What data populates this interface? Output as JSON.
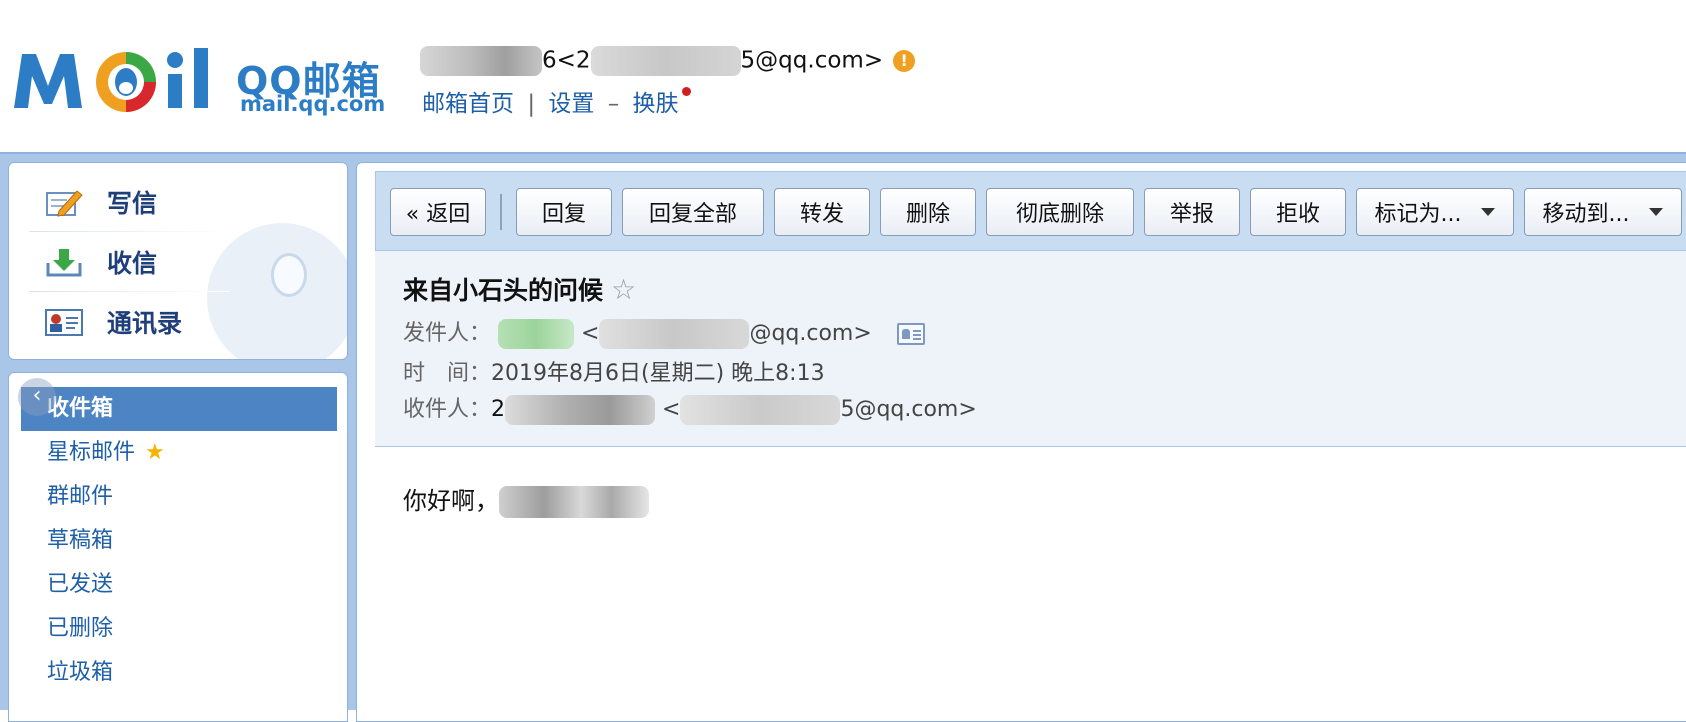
{
  "header": {
    "logo_qq": "QQ邮箱",
    "logo_url": "mail.qq.com",
    "account_visible_prefix": "6<2",
    "account_visible_suffix": "5@qq.com>",
    "nav": {
      "home": "邮箱首页",
      "sep": "|",
      "settings": "设置",
      "dash": "–",
      "skin": "换肤"
    }
  },
  "sidebar": {
    "quick_actions": [
      {
        "label": "写信"
      },
      {
        "label": "收信"
      },
      {
        "label": "通讯录"
      }
    ],
    "folders": [
      {
        "label": "收件箱",
        "active": true
      },
      {
        "label": "星标邮件"
      },
      {
        "label": "群邮件"
      },
      {
        "label": "草稿箱"
      },
      {
        "label": "已发送"
      },
      {
        "label": "已删除"
      },
      {
        "label": "垃圾箱"
      }
    ],
    "star": "★",
    "collapse": "‹"
  },
  "toolbar": {
    "back": "« 返回",
    "reply": "回复",
    "reply_all": "回复全部",
    "forward": "转发",
    "delete": "删除",
    "delete_permanent": "彻底删除",
    "report": "举报",
    "reject": "拒收",
    "mark_as": "标记为...",
    "move_to": "移动到..."
  },
  "mail": {
    "subject": "来自小石头的问候",
    "star": "☆",
    "sender_label": "发件人：",
    "sender_email_visible": "@qq.com>",
    "sender_lt": "<",
    "time_label": "时　间：",
    "time_value": "2019年8月6日(星期二) 晚上8:13",
    "recipient_label": "收件人：",
    "recipient_name_prefix": "2",
    "recipient_lt": "<",
    "recipient_email_visible": "5@qq.com>",
    "greeting": "你好啊，"
  }
}
